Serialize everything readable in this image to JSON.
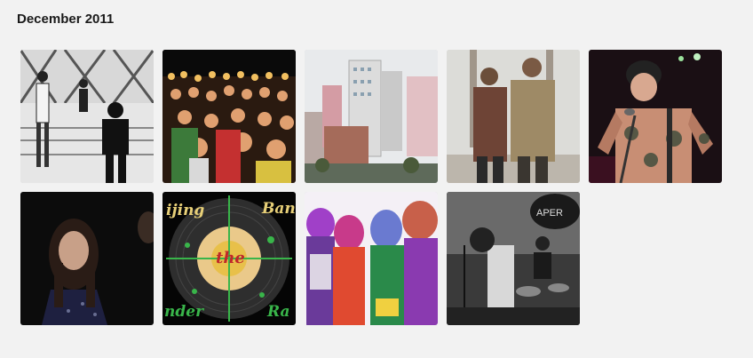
{
  "section": {
    "title": "December 2011"
  },
  "thumbnails": [
    {
      "alt": "band-bw-bridge-photo"
    },
    {
      "alt": "crowd-concert-photo"
    },
    {
      "alt": "city-buildings-photo"
    },
    {
      "alt": "two-men-photo"
    },
    {
      "alt": "tattooed-singer-photo"
    },
    {
      "alt": "woman-portrait-photo"
    },
    {
      "alt": "record-logo-artwork",
      "text": {
        "top_left": "ijing",
        "top_right": "Ban",
        "center": "the",
        "bottom_left": "nder",
        "bottom_right": "Ra"
      }
    },
    {
      "alt": "colorful-band-photo"
    },
    {
      "alt": "band-rehearsal-photo",
      "text": {
        "sign": "APER"
      }
    }
  ]
}
